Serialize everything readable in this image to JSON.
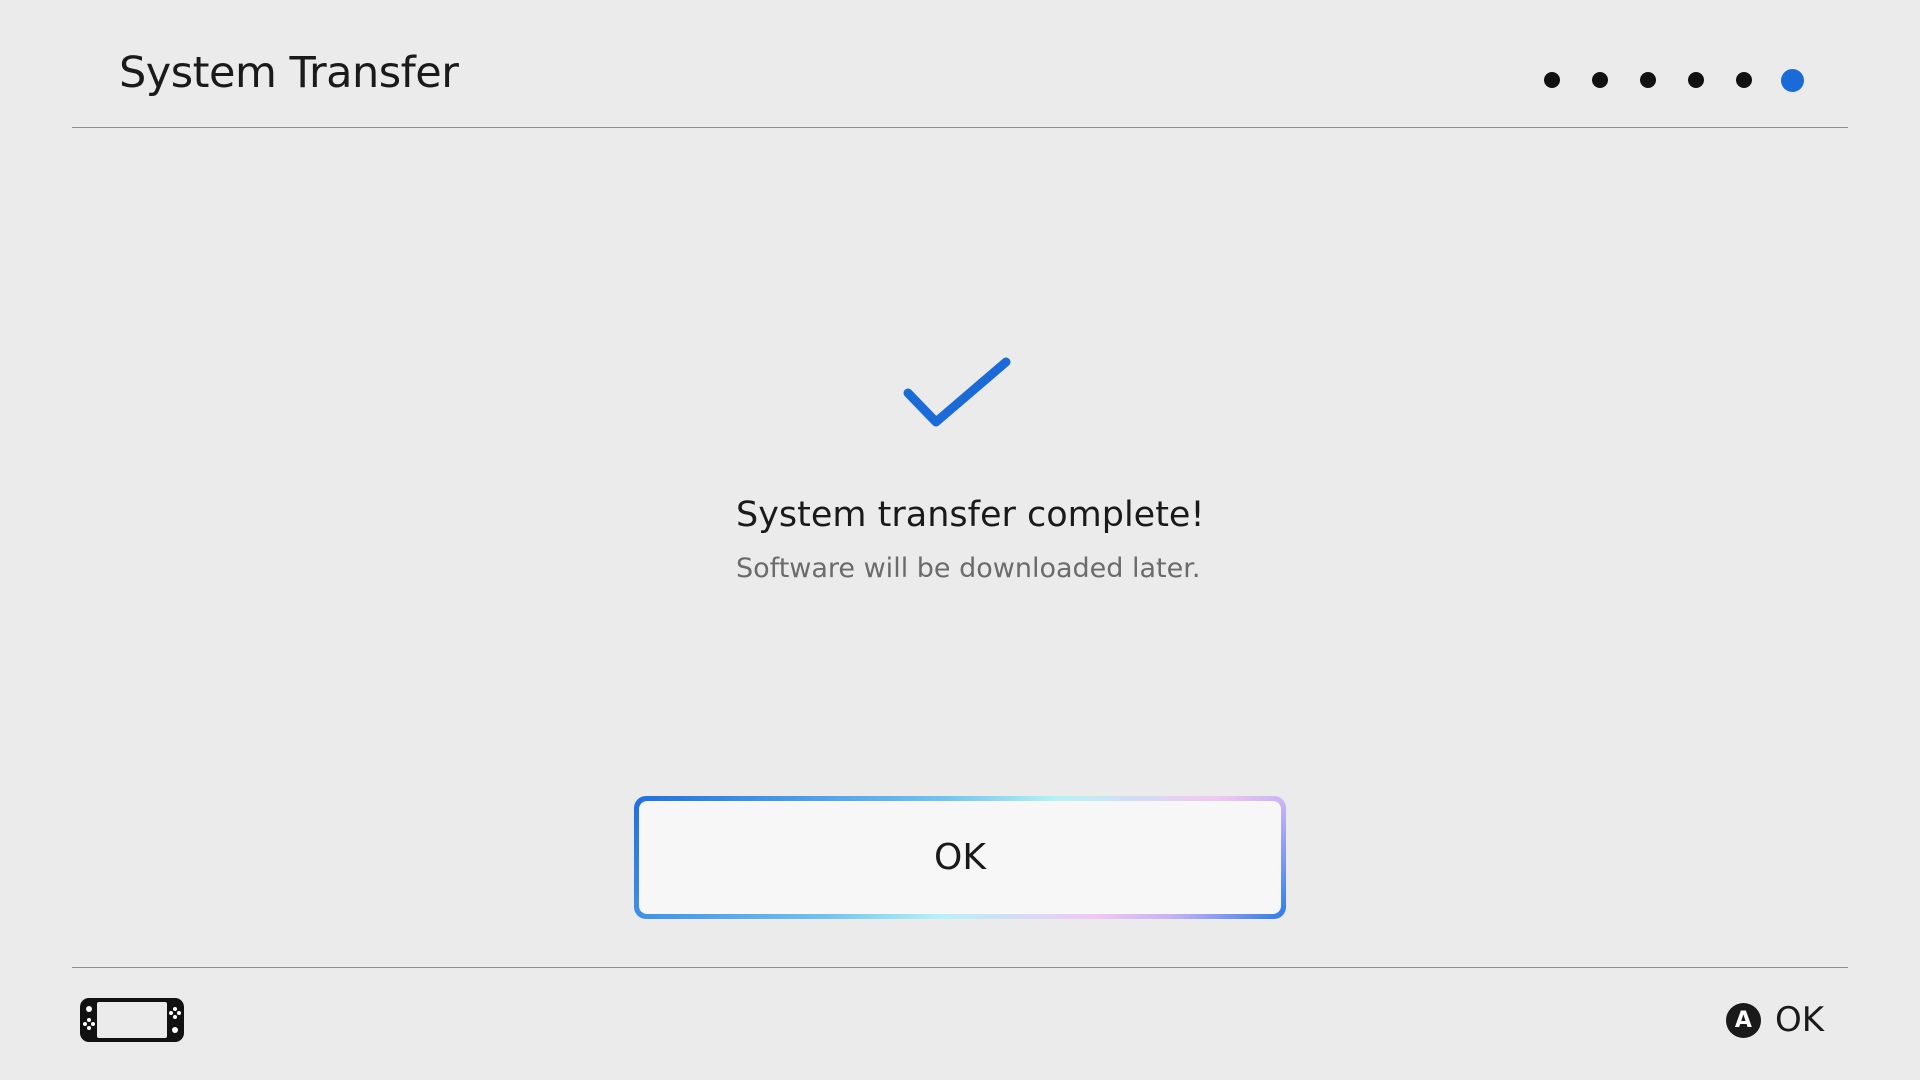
{
  "header": {
    "title": "System Transfer"
  },
  "progress": {
    "total_steps": 6,
    "current_step": 6,
    "active_color": "#1a6ad8",
    "inactive_color": "#111111"
  },
  "status": {
    "icon": "checkmark-icon",
    "title": "System transfer complete!",
    "subtitle": "Software will be downloaded later."
  },
  "ok_button": {
    "label": "OK"
  },
  "footer": {
    "console_icon": "handheld-console-icon",
    "a_button_glyph": "A",
    "a_button_label": "OK"
  },
  "colors": {
    "background": "#ebebeb",
    "accent": "#1a6ad8"
  }
}
